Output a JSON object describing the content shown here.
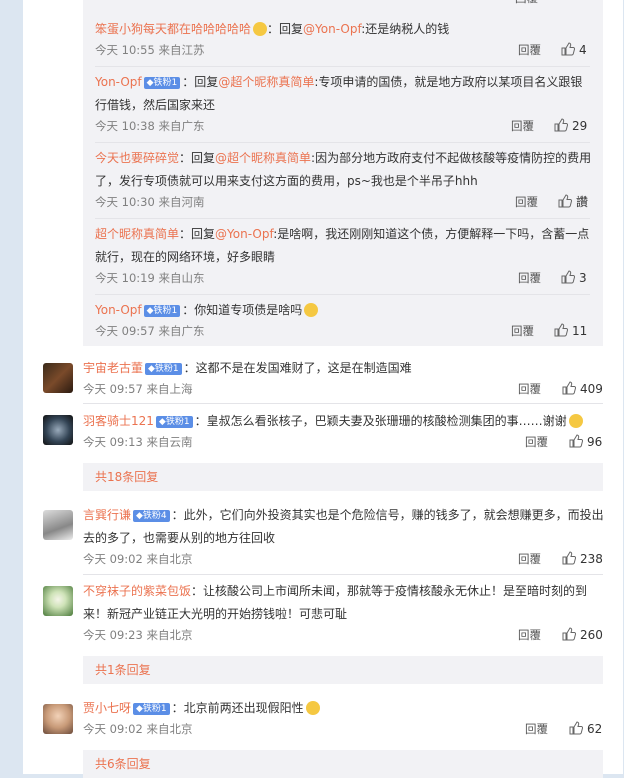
{
  "top_partial": {
    "reply": "回覆"
  },
  "nested": [
    {
      "user": "笨蛋小狗每天都在哈哈哈哈哈",
      "prefix": "：回复",
      "mention": "@Yon-Opf",
      "text": ":还是纳税人的钱",
      "time": "今天 10:55 来自江苏",
      "reply": "回覆",
      "likes": "4"
    },
    {
      "user": "Yon-Opf",
      "badge": "◆铁粉1",
      "prefix": "：回复",
      "mention": "@超个昵称真简单",
      "text1": ":专项申请的国债，就是地方政府以某项目名义跟银",
      "text2": "行借钱，然后国家来还",
      "time": "今天 10:38 来自广东",
      "reply": "回覆",
      "likes": "29"
    },
    {
      "user": "今天也要碎碎觉",
      "prefix": "：回复",
      "mention": "@超个昵称真简单",
      "text1": ":因为部分地方政府支付不起做核酸等疫情防控的费用",
      "text2": "了，发行专项债就可以用来支付这方面的费用，ps~我也是个半吊子hhh",
      "time": "今天 10:30 来自河南",
      "reply": "回覆",
      "likes": "讚"
    },
    {
      "user": "超个昵称真简单",
      "prefix": "：回复",
      "mention": "@Yon-Opf",
      "text1": ":是啥啊，我还刚刚知道这个债，方便解释一下吗，含蓄一点",
      "text2": "就行，现在的网络环境，好多眼睛",
      "time": "今天 10:19 来自山东",
      "reply": "回覆",
      "likes": "3"
    },
    {
      "user": "Yon-Opf",
      "badge": "◆铁粉1",
      "text": "：你知道专项债是啥吗",
      "time": "今天 09:57 来自广东",
      "reply": "回覆",
      "likes": "11"
    }
  ],
  "comments": [
    {
      "user": "宇宙老古董",
      "badge": "◆铁粉1",
      "text": "：这都不是在发国难财了，这是在制造国难",
      "time": "今天 09:57 来自上海",
      "reply": "回覆",
      "likes": "409"
    },
    {
      "user": "羽客骑士121",
      "badge": "◆铁粉1",
      "text": "：皇叔怎么看张核子，巴颖夫妻及张珊珊的核酸检测集团的事……谢谢",
      "time": "今天 09:13 来自云南",
      "reply": "回覆",
      "likes": "96",
      "more": "共18条回复"
    },
    {
      "user": "言巽行谦",
      "badge": "◆铁粉4",
      "text1": "：此外，它们向外投资其实也是个危险信号，赚的钱多了，就会想赚更多，而投出",
      "text2": "去的多了，也需要从别的地方往回收",
      "time": "今天 09:02 来自北京",
      "reply": "回覆",
      "likes": "238"
    },
    {
      "user": "不穿袜子的紫菜包饭",
      "text1": "：让核酸公司上市闻所未闻，那就等于疫情核酸永无休止！是至暗时刻的到",
      "text2": "来！新冠产业链正大光明的开始捞钱啦！可悲可耻",
      "time": "今天 09:23 来自北京",
      "reply": "回覆",
      "likes": "260",
      "more": "共1条回复"
    },
    {
      "user": "贾小七呀",
      "badge": "◆铁粉1",
      "text": "：北京前两还出现假阳性",
      "time": "今天 09:02 来自北京",
      "reply": "回覆",
      "likes": "62",
      "more": "共6条回复"
    }
  ]
}
